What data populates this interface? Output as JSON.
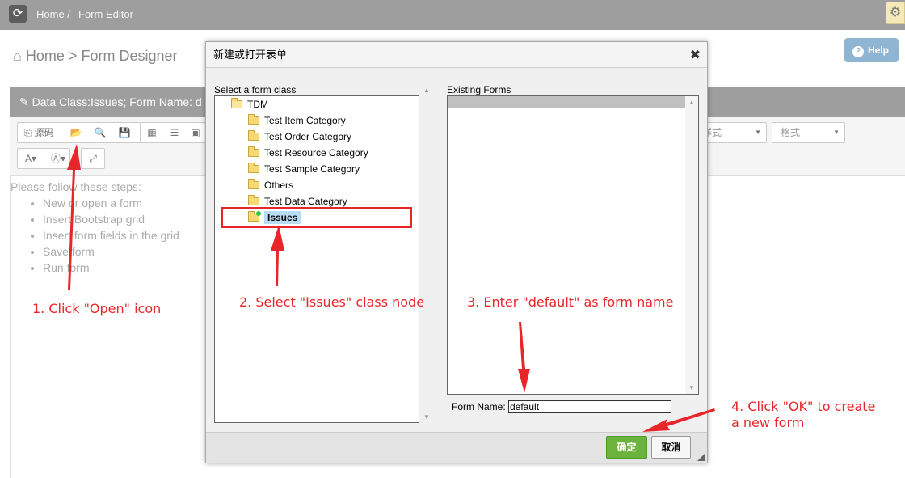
{
  "topbar": {
    "refresh_icon": "refresh-icon",
    "breadcrumb_home": "Home /",
    "breadcrumb_current": "Form Editor",
    "settings_icon": "gear-icon"
  },
  "page": {
    "home_label": "Home",
    "separator": ">",
    "title": "Form Designer",
    "help_label": "Help"
  },
  "panel": {
    "header": "Data Class:Issues; Form Name: d",
    "toolbar": {
      "source_label": "源码",
      "style_label": "样式",
      "format_label": "格式"
    },
    "intro": "Please follow these steps:",
    "steps": [
      "New or open a form",
      "Insert Bootstrap grid",
      "Insert form fields in the grid",
      "Save form",
      "Run form"
    ]
  },
  "dialog": {
    "title": "新建或打开表单",
    "close": "✖",
    "tree_label": "Select a form class",
    "tree": {
      "root": "TDM",
      "children": [
        "Test Item Category",
        "Test Order Category",
        "Test Resource Category",
        "Test Sample Category",
        "Others",
        "Test Data Category",
        "Issues"
      ],
      "selected": "Issues"
    },
    "forms_label": "Existing Forms",
    "form_name_label": "Form Name:",
    "form_name_value": "default",
    "ok_label": "确定",
    "cancel_label": "取消"
  },
  "annotations": {
    "step1": "1. Click \"Open\" icon",
    "step2": "2. Select \"Issues\" class node",
    "step3": "3. Enter \"default\" as form name",
    "step4_line1": "4. Click \"OK\" to create",
    "step4_line2": "a new form"
  },
  "colors": {
    "annotation": "#e8262a",
    "topbar": "#9e9e9e",
    "ok_button": "#6cb33e",
    "help_button": "#8fb5d3",
    "selection": "#b9dcf5"
  }
}
